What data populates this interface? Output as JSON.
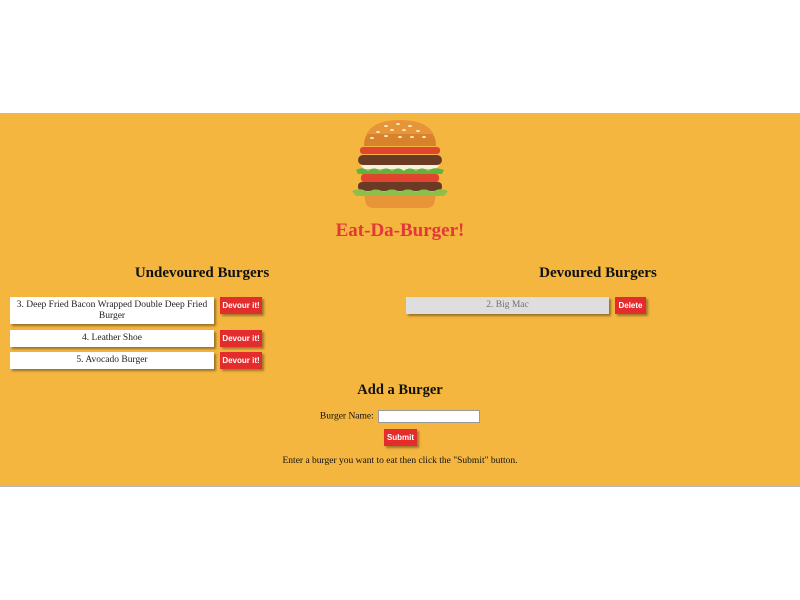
{
  "app": {
    "title": "Eat-Da-Burger!"
  },
  "undevoured": {
    "heading": "Undevoured Burgers",
    "items": [
      {
        "label": "3. Deep Fried Bacon Wrapped Double Deep Fried Burger",
        "action": "Devour it!"
      },
      {
        "label": "4. Leather Shoe",
        "action": "Devour it!"
      },
      {
        "label": "5. Avocado Burger",
        "action": "Devour it!"
      }
    ]
  },
  "devoured": {
    "heading": "Devoured Burgers",
    "items": [
      {
        "label": "2. Big Mac",
        "action": "Delete"
      }
    ]
  },
  "add_form": {
    "heading": "Add a Burger",
    "field_label": "Burger Name:",
    "field_value": "",
    "submit_label": "Submit",
    "hint": "Enter a burger you want to eat then click the \"Submit\" button."
  },
  "colors": {
    "background": "#f4b63f",
    "accent": "#e23838",
    "button": "#e42c2c"
  },
  "icons": {
    "logo": "burger-logo-icon"
  }
}
